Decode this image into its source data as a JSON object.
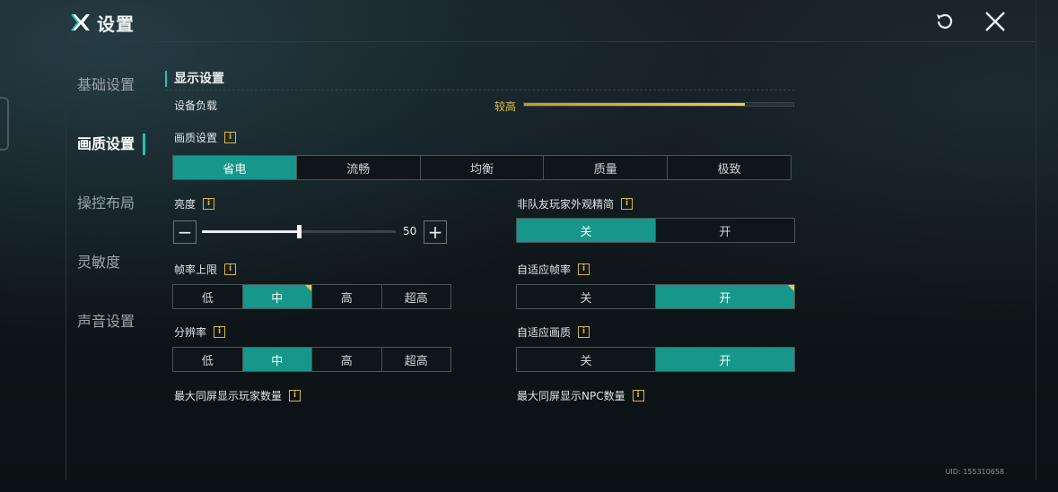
{
  "app": {
    "title": "设置",
    "uid": "UID: 155310658"
  },
  "icons": {
    "logo": "x-logo-icon",
    "reset": "reset-icon",
    "close": "close-icon",
    "info": "info-icon"
  },
  "colors": {
    "accent": "#16978a",
    "load_bar": "#e2c04a",
    "badge": "#f0c63a"
  },
  "sidebar": {
    "items": [
      {
        "label": "基础设置",
        "active": false
      },
      {
        "label": "画质设置",
        "active": true
      },
      {
        "label": "操控布局",
        "active": false
      },
      {
        "label": "灵敏度",
        "active": false
      },
      {
        "label": "声音设置",
        "active": false
      }
    ]
  },
  "section": {
    "title": "显示设置"
  },
  "device_load": {
    "label": "设备负载",
    "value_label": "较高",
    "level": 0.82
  },
  "quality": {
    "label": "画质设置",
    "info": "i",
    "options": [
      "省电",
      "流畅",
      "均衡",
      "质量",
      "极致"
    ],
    "selected": 0
  },
  "brightness": {
    "label": "亮度",
    "info": "i",
    "value": "50",
    "minus": "−",
    "plus": "+",
    "level": 0.5
  },
  "non_team_simplified": {
    "label": "非队友玩家外观精简",
    "info": "i",
    "options": [
      "关",
      "开"
    ],
    "selected": 0
  },
  "frame_limit": {
    "label": "帧率上限",
    "info": "i",
    "options": [
      "低",
      "中",
      "高",
      "超高"
    ],
    "selected": 1
  },
  "adaptive_framerate": {
    "label": "自适应帧率",
    "info": "i",
    "options": [
      "关",
      "开"
    ],
    "selected": 1
  },
  "resolution": {
    "label": "分辨率",
    "info": "i",
    "options": [
      "低",
      "中",
      "高",
      "超高"
    ],
    "selected": 1
  },
  "adaptive_quality": {
    "label": "自适应画质",
    "info": "i",
    "options": [
      "关",
      "开"
    ],
    "selected": 1
  },
  "max_players": {
    "label": "最大同屏显示玩家数量",
    "info": "i"
  },
  "max_npc": {
    "label": "最大同屏显示NPC数量",
    "info": "i"
  }
}
